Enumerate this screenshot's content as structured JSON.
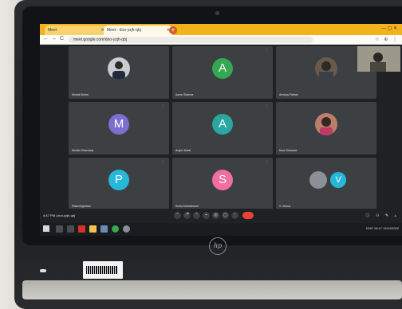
{
  "browser": {
    "tab1_title": "Meet",
    "tab2_title": "Meet - doo-yzjh-qbj",
    "new_tab": "+",
    "url": "meet.google.com/doo-yzjh-qbj",
    "nav_back": "←",
    "nav_forward": "→",
    "nav_reload": "C",
    "window_controls": "—  ▢  ✕",
    "tools": "☆ ⊕ ⋮"
  },
  "meet": {
    "tiles": [
      {
        "name": "Mohak Bohra",
        "type": "photo",
        "photo_color": "#c9cbd0"
      },
      {
        "name": "Aarav Sharma",
        "type": "initial",
        "initial": "A",
        "color": "#34a853"
      },
      {
        "name": "Amulya Pathak",
        "type": "photo",
        "photo_color": "#6b5a4a"
      },
      {
        "name": "Mohsin Bhardwaj",
        "type": "initial",
        "initial": "M",
        "color": "#7b6fd1"
      },
      {
        "name": "Angel Jindal",
        "type": "initial",
        "initial": "A",
        "color": "#2aa7a1"
      },
      {
        "name": "Noor Dhanwar",
        "type": "photo",
        "photo_color": "#b97f6a"
      },
      {
        "name": "Palavi Agrahari",
        "type": "initial",
        "initial": "P",
        "color": "#27b7d8"
      },
      {
        "name": "Sonia Maheshwari",
        "type": "initial",
        "initial": "S",
        "color": "#f06ea1"
      },
      {
        "name": "V. Verma",
        "type": "initial",
        "initial": "V",
        "color": "#27b7d8"
      }
    ],
    "meeting_time": "4:47 PM  |  doo-yzjh-qbj",
    "controls": [
      "⌃",
      "🎤",
      "⌃",
      "⌁",
      "◎",
      "▢",
      "⋮"
    ],
    "right_controls": "ⓘ ⚇ ✎ ▵"
  },
  "taskbar": {
    "icons": [
      {
        "name": "search",
        "color": "#4a4d55"
      },
      {
        "name": "task-view",
        "color": "#4a4d55"
      },
      {
        "name": "acrobat",
        "color": "#d93025"
      },
      {
        "name": "file-explorer",
        "color": "#f3c54b"
      },
      {
        "name": "photos",
        "color": "#6b8bb3"
      },
      {
        "name": "chrome",
        "color": "#34a853"
      },
      {
        "name": "settings",
        "color": "#8a8d94"
      }
    ],
    "tray": "ENG  16:47  12/04/2022"
  },
  "laptop": {
    "brand": "hp"
  }
}
